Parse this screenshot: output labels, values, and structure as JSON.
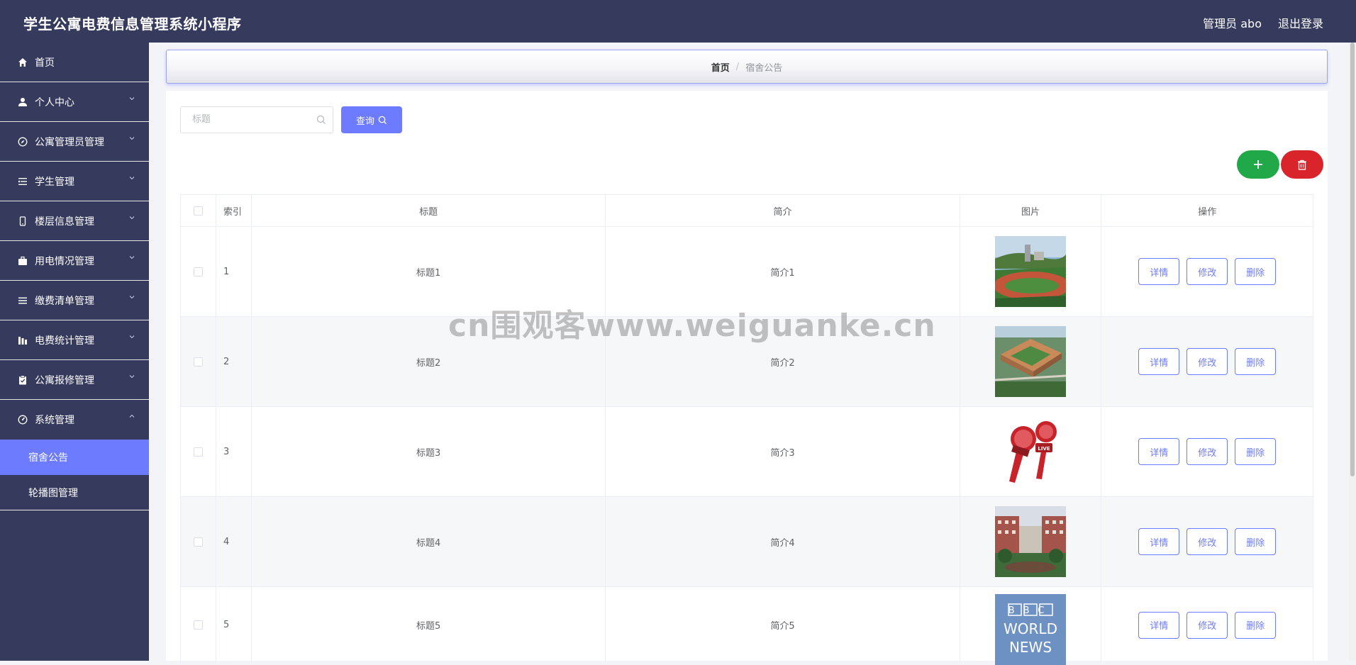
{
  "header": {
    "app_title": "学生公寓电费信息管理系统小程序",
    "admin_label": "管理员 abo",
    "logout_label": "退出登录"
  },
  "sidebar": {
    "items": [
      {
        "label": "首页",
        "icon": "home-icon"
      },
      {
        "label": "个人中心",
        "icon": "user-icon"
      },
      {
        "label": "公寓管理员管理",
        "icon": "compass-icon"
      },
      {
        "label": "学生管理",
        "icon": "list-icon"
      },
      {
        "label": "楼层信息管理",
        "icon": "mobile-icon"
      },
      {
        "label": "用电情况管理",
        "icon": "briefcase-icon"
      },
      {
        "label": "缴费清单管理",
        "icon": "menu-icon"
      },
      {
        "label": "电费统计管理",
        "icon": "chart-icon"
      },
      {
        "label": "公寓报修管理",
        "icon": "clipboard-icon"
      },
      {
        "label": "系统管理",
        "icon": "gauge-icon"
      }
    ],
    "sub_items": [
      {
        "label": "宿舍公告",
        "active": true
      },
      {
        "label": "轮播图管理",
        "active": false
      }
    ]
  },
  "breadcrumb": {
    "home": "首页",
    "separator": "/",
    "current": "宿舍公告"
  },
  "search": {
    "placeholder": "标题",
    "value": "",
    "button_label": "查询"
  },
  "table": {
    "headers": {
      "index": "索引",
      "title": "标题",
      "brief": "简介",
      "picture": "图片",
      "actions": "操作"
    },
    "rows": [
      {
        "index": "1",
        "title": "标题1",
        "brief": "简介1",
        "picture": "campus-field-photo"
      },
      {
        "index": "2",
        "title": "标题2",
        "brief": "简介2",
        "picture": "campus-aerial-photo"
      },
      {
        "index": "3",
        "title": "标题3",
        "brief": "简介3",
        "picture": "live-microphones-graphic"
      },
      {
        "index": "4",
        "title": "标题4",
        "brief": "简介4",
        "picture": "campus-building-photo"
      },
      {
        "index": "5",
        "title": "标题5",
        "brief": "简介5",
        "picture": "bbc-world-news-logo"
      }
    ],
    "action_labels": {
      "detail": "详情",
      "edit": "修改",
      "delete": "删除"
    }
  },
  "thumb_text": {
    "live_badge": "LIVE",
    "bbc": "BBC",
    "world": "WORLD",
    "news": "NEWS"
  },
  "watermark": "cn围观客www.weiguanke.cn",
  "colors": {
    "topbar": "#363a5c",
    "accent": "#6c7bff",
    "add": "#21a849",
    "delete": "#d9242b"
  }
}
